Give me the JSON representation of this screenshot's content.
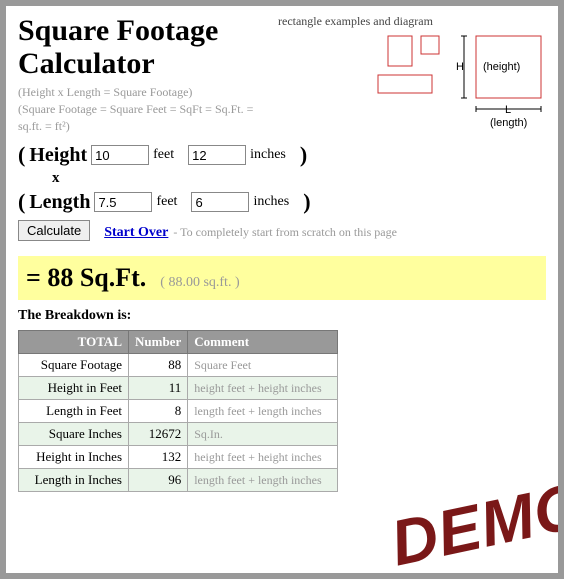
{
  "title": "Square Footage Calculator",
  "subtitle_lines": [
    "(Height x Length = Square Footage)",
    "(Square Footage = Square Feet = SqFt = Sq.Ft. = sq.ft. = ft²)"
  ],
  "diagram": {
    "label": "rectangle examples and diagram",
    "height_label": "(height)",
    "length_label": "(length)",
    "h_char": "H",
    "l_char": "L"
  },
  "inputs": {
    "height_label": "Height",
    "length_label": "Length",
    "height_feet": "10",
    "height_inches": "12",
    "length_feet": "7.5",
    "length_inches": "6",
    "feet_unit": "feet",
    "inches_unit": "inches",
    "times": "x"
  },
  "buttons": {
    "calculate": "Calculate",
    "start_over": "Start Over",
    "start_over_note": " - To completely start from scratch on this page"
  },
  "result": {
    "main": "= 88 Sq.Ft.",
    "sub": "( 88.00 sq.ft. )"
  },
  "breakdown": {
    "title": "The Breakdown is:",
    "headers": {
      "total": "TOTAL",
      "number": "Number",
      "comment": "Comment"
    },
    "rows": [
      {
        "name": "Square Footage",
        "number": "88",
        "comment": "Square Feet"
      },
      {
        "name": "Height in Feet",
        "number": "11",
        "comment": "height feet + height inches"
      },
      {
        "name": "Length in Feet",
        "number": "8",
        "comment": "length feet + length inches"
      },
      {
        "name": "Square Inches",
        "number": "12672",
        "comment": "Sq.In."
      },
      {
        "name": "Height in Inches",
        "number": "132",
        "comment": "height feet + height inches"
      },
      {
        "name": "Length in Inches",
        "number": "96",
        "comment": "length feet + length inches"
      }
    ]
  },
  "stamp": "DEMO"
}
